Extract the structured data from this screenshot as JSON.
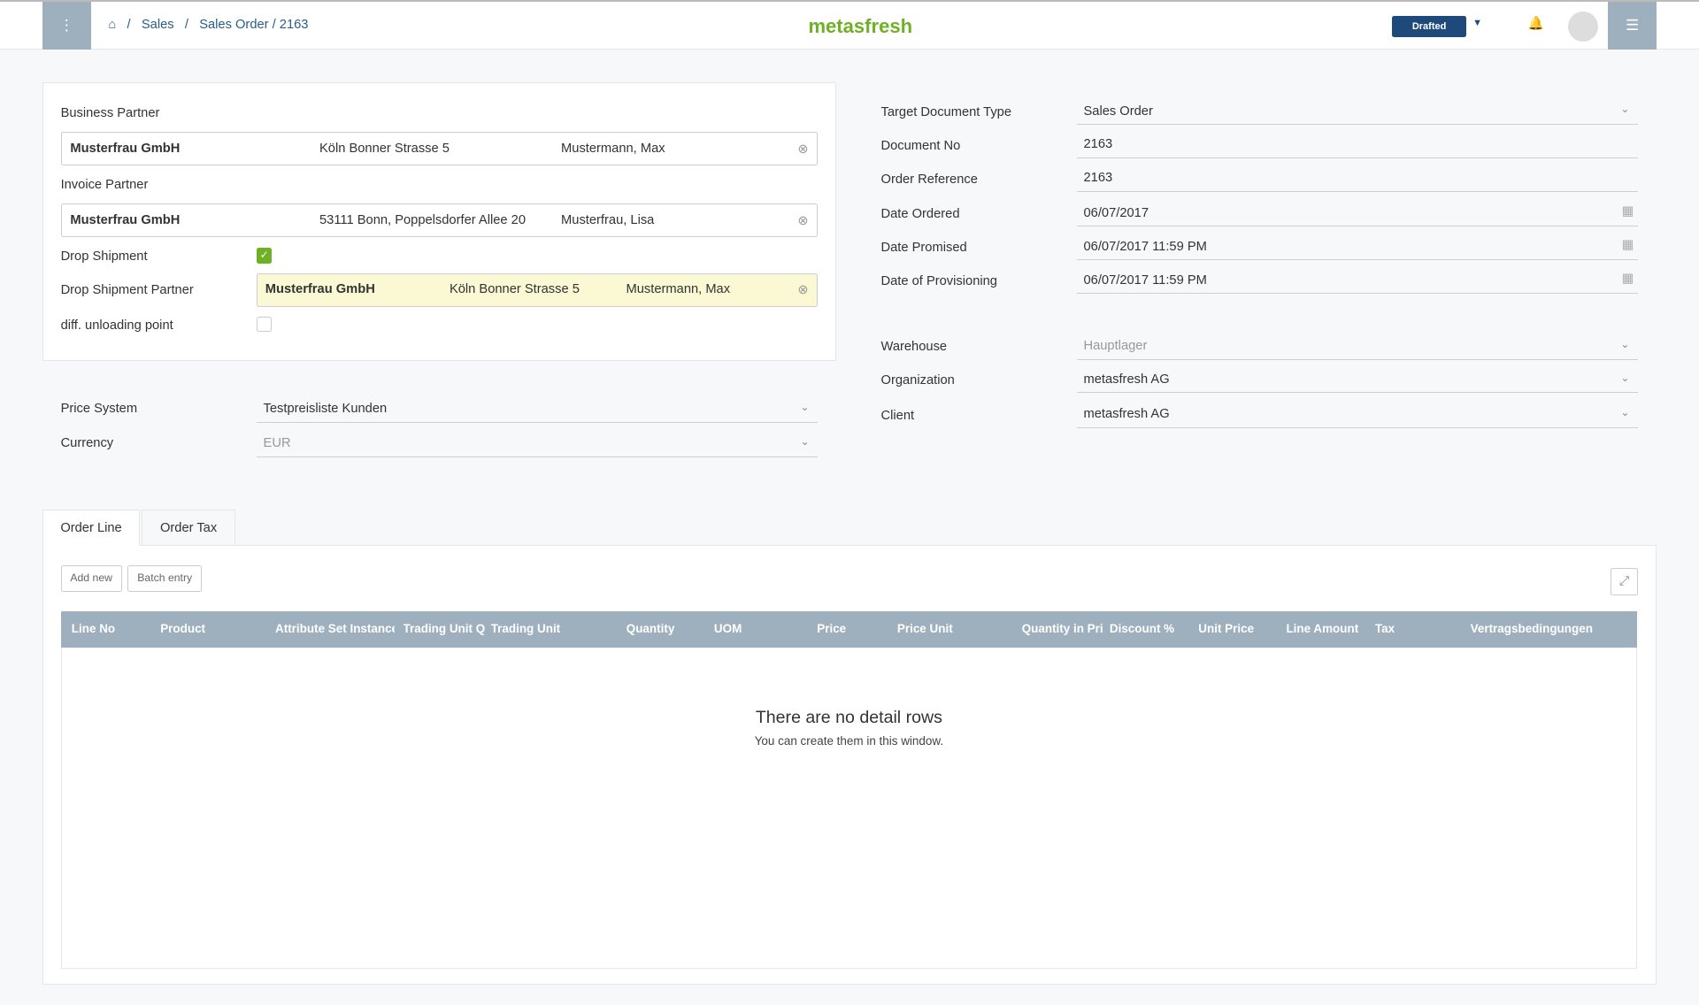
{
  "header": {
    "breadcrumb": [
      "Sales",
      "Sales Order / 2163"
    ],
    "logo": "metasfresh",
    "status": "Drafted"
  },
  "left": {
    "business_partner": {
      "label": "Business Partner",
      "name": "Musterfrau GmbH",
      "address": "Köln Bonner Strasse 5",
      "contact": "Mustermann, Max"
    },
    "invoice_partner": {
      "label": "Invoice Partner",
      "name": "Musterfrau GmbH",
      "address": "53111 Bonn, Poppelsdorfer Allee 20",
      "contact": "Musterfrau, Lisa"
    },
    "drop_shipment": {
      "label": "Drop Shipment",
      "checked": true
    },
    "drop_shipment_partner": {
      "label": "Drop Shipment Partner",
      "name": "Musterfrau GmbH",
      "address": "Köln Bonner Strasse 5",
      "contact": "Mustermann, Max"
    },
    "diff_unloading": {
      "label": "diff. unloading point",
      "checked": false
    },
    "price_system": {
      "label": "Price System",
      "value": "Testpreisliste Kunden"
    },
    "currency": {
      "label": "Currency",
      "value": "EUR"
    }
  },
  "right": [
    {
      "label": "Target Document Type",
      "value": "Sales Order",
      "type": "select"
    },
    {
      "label": "Document No",
      "value": "2163",
      "type": "text"
    },
    {
      "label": "Order Reference",
      "value": "2163",
      "type": "text"
    },
    {
      "label": "Date Ordered",
      "value": "06/07/2017",
      "type": "date"
    },
    {
      "label": "Date Promised",
      "value": "06/07/2017 11:59 PM",
      "type": "date"
    },
    {
      "label": "Date of Provisioning",
      "value": "06/07/2017 11:59 PM",
      "type": "date"
    },
    {
      "label": "Warehouse",
      "value": "Hauptlager",
      "type": "select"
    },
    {
      "label": "Organization",
      "value": "metasfresh AG",
      "type": "select"
    },
    {
      "label": "Client",
      "value": "metasfresh AG",
      "type": "select"
    }
  ],
  "tabs": [
    "Order Line",
    "Order Tax"
  ],
  "buttons": {
    "add_new": "Add new",
    "batch_entry": "Batch entry"
  },
  "table": {
    "columns": [
      "Line No",
      "Product",
      "Attribute Set Instance",
      "Trading Unit Q",
      "Trading Unit",
      "Quantity",
      "UOM",
      "Price",
      "Price Unit",
      "Quantity in Pri",
      "Discount %",
      "Unit Price",
      "Line Amount",
      "Tax",
      "Vertragsbedingungen"
    ],
    "empty_title": "There are no detail rows",
    "empty_sub": "You can create them in this window."
  }
}
